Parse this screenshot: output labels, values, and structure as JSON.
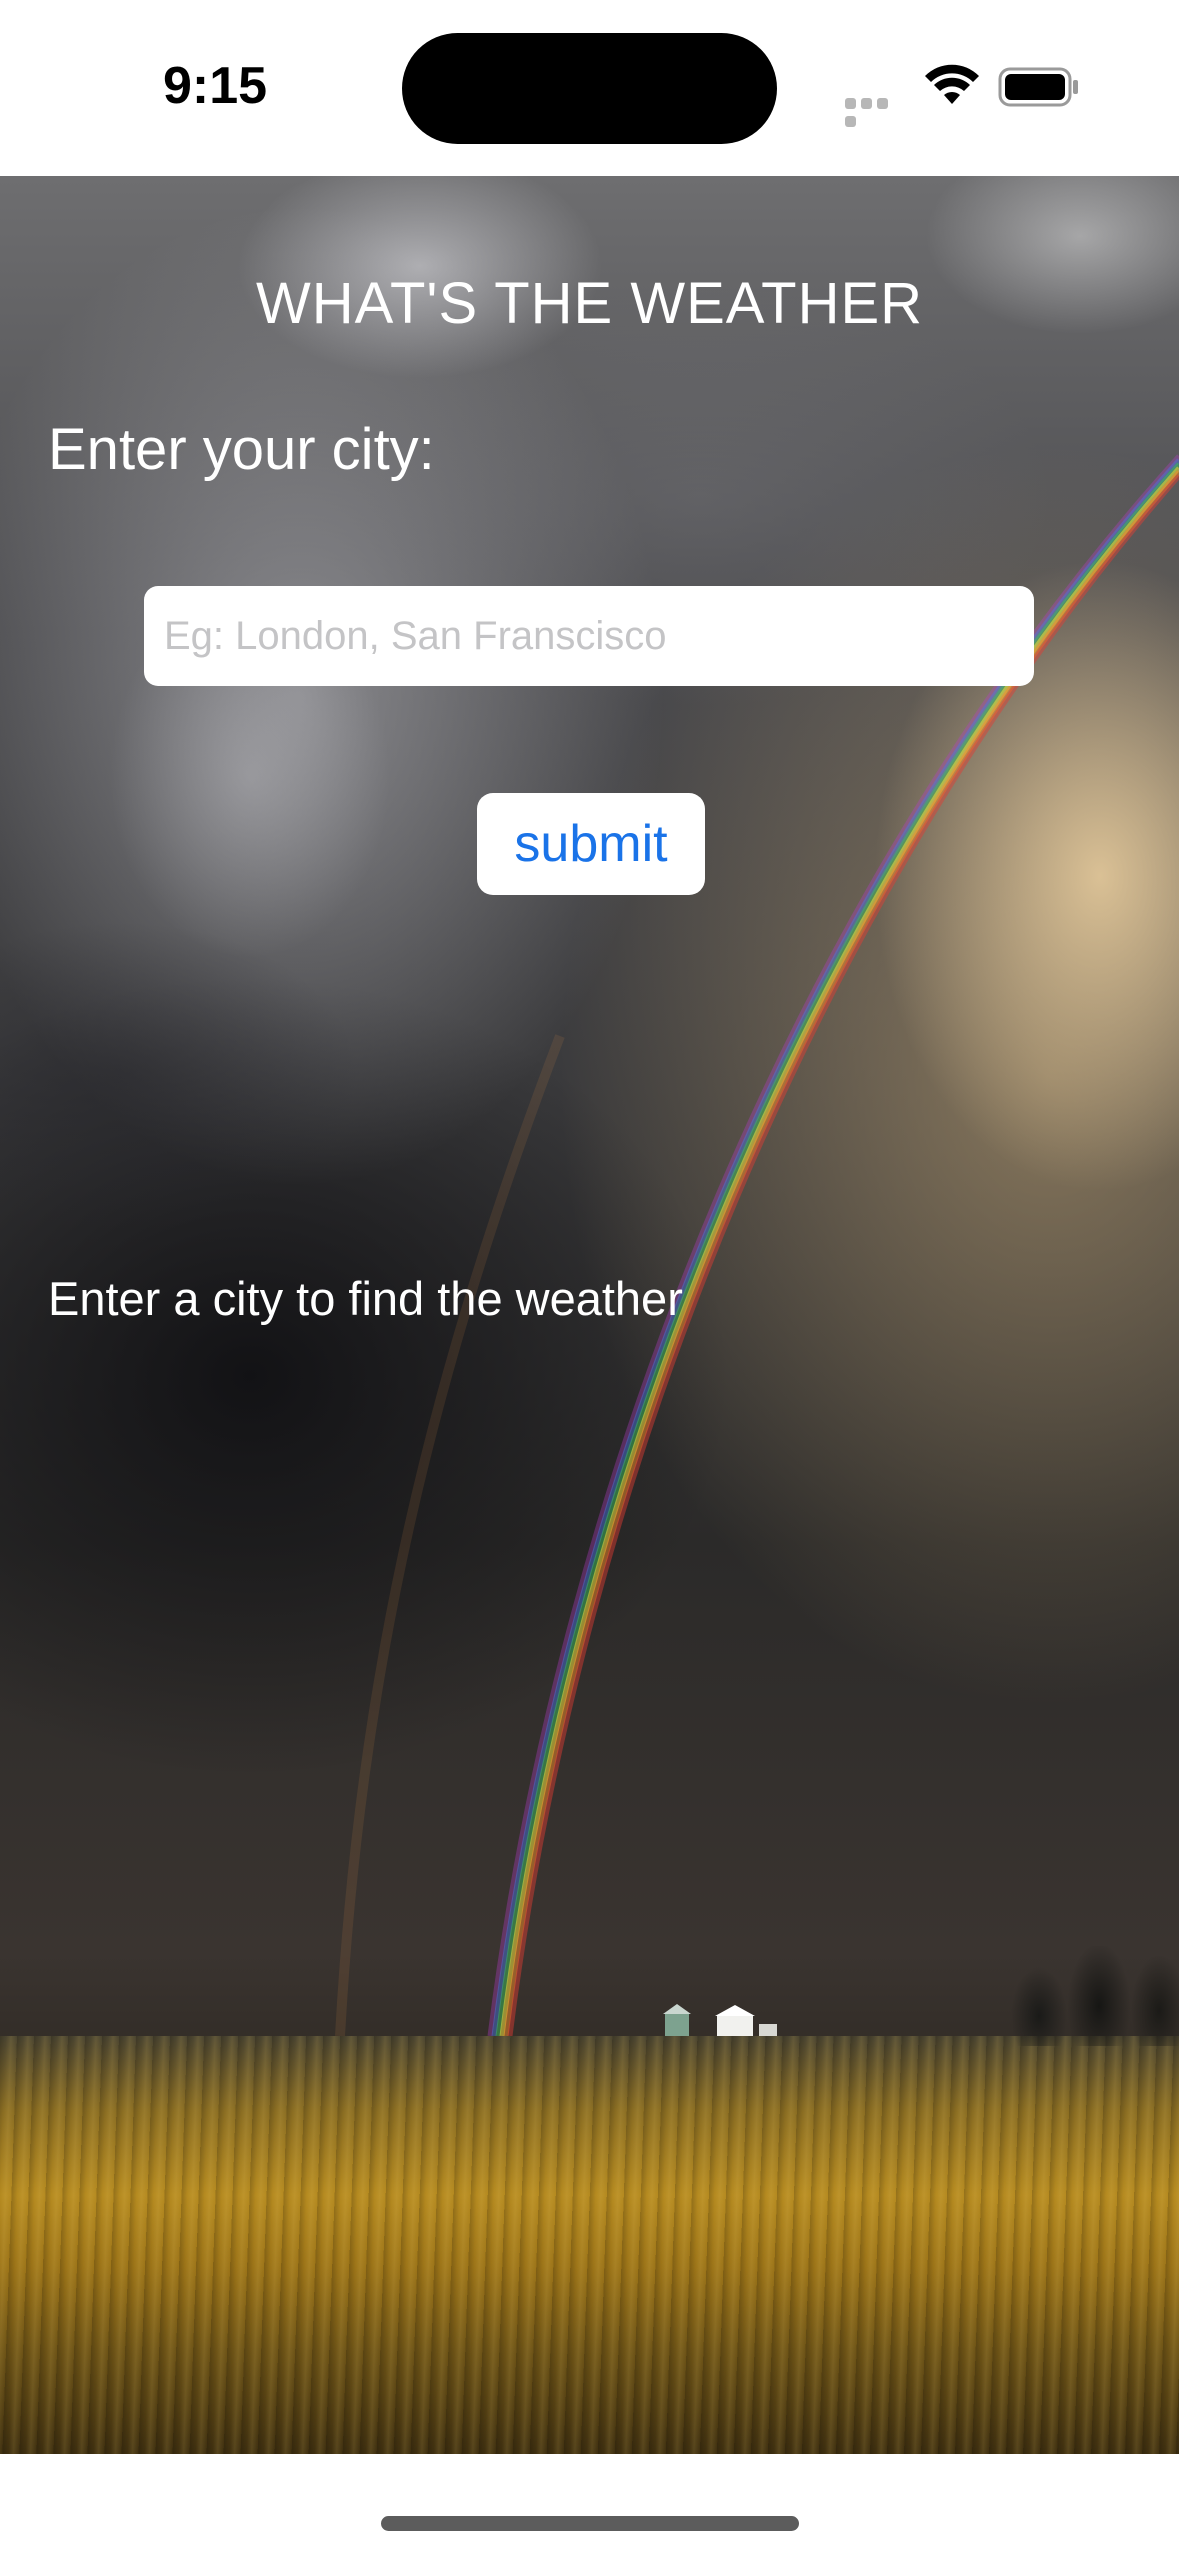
{
  "status_bar": {
    "time": "9:15",
    "icons": [
      "cellular-signal-icon",
      "wifi-icon",
      "battery-icon"
    ]
  },
  "app": {
    "title": "WHAT'S THE WEATHER",
    "city_label": "Enter your city:",
    "city_input": {
      "value": "",
      "placeholder": "Eg: London, San Franscisco"
    },
    "submit_label": "submit",
    "result_text": "Enter a city to find the weather"
  },
  "colors": {
    "text": "#ffffff",
    "button_text": "#1a73e8",
    "placeholder": "#c4c4c6"
  }
}
